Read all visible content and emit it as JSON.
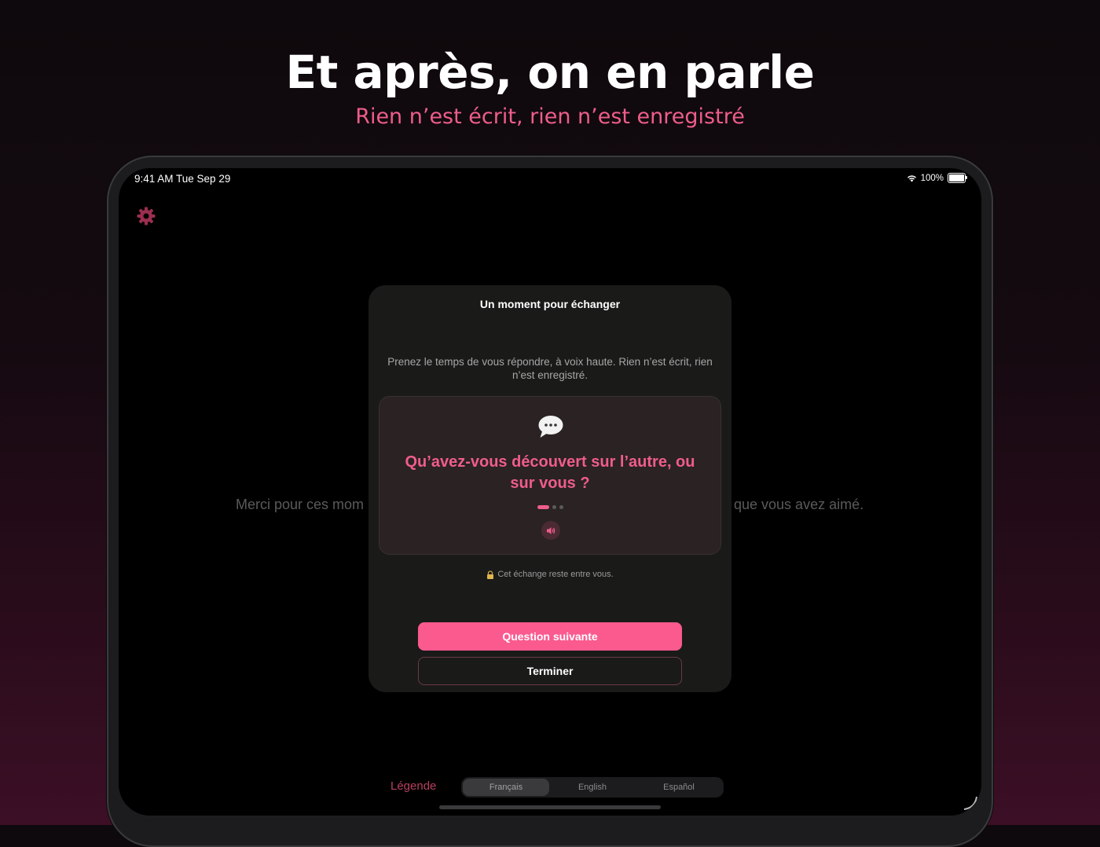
{
  "header": {
    "title": "Et après, on en parle",
    "subtitle": "Rien n’est écrit, rien n’est enregistré"
  },
  "status_bar": {
    "time": "9:41 AM  Tue Sep 29",
    "battery": "100%",
    "icons": [
      "wifi-icon",
      "battery-icon"
    ]
  },
  "background": {
    "text_left": "Merci pour ces mom",
    "text_right": "que vous avez aimé."
  },
  "modal": {
    "title": "Un moment pour échanger",
    "description": "Prenez le temps de vous répondre, à voix haute. Rien n’est écrit, rien n’est enregistré.",
    "card": {
      "icon": "speech-bubble-icon",
      "question": "Qu’avez-vous découvert sur l’autre, ou sur vous ?",
      "page_total": 3,
      "page_active": 1
    },
    "privacy_note": "Cet échange reste entre vous.",
    "primary_button": "Question suivante",
    "secondary_button": "Terminer"
  },
  "footer": {
    "legend_label": "Légende",
    "languages": [
      "Français",
      "English",
      "Español"
    ],
    "selected_language": "Français"
  },
  "colors": {
    "accent": "#fb5a8f",
    "accent_text": "#ef5d8a",
    "modal_bg": "#1a1a19",
    "card_bg": "#2a2223"
  }
}
